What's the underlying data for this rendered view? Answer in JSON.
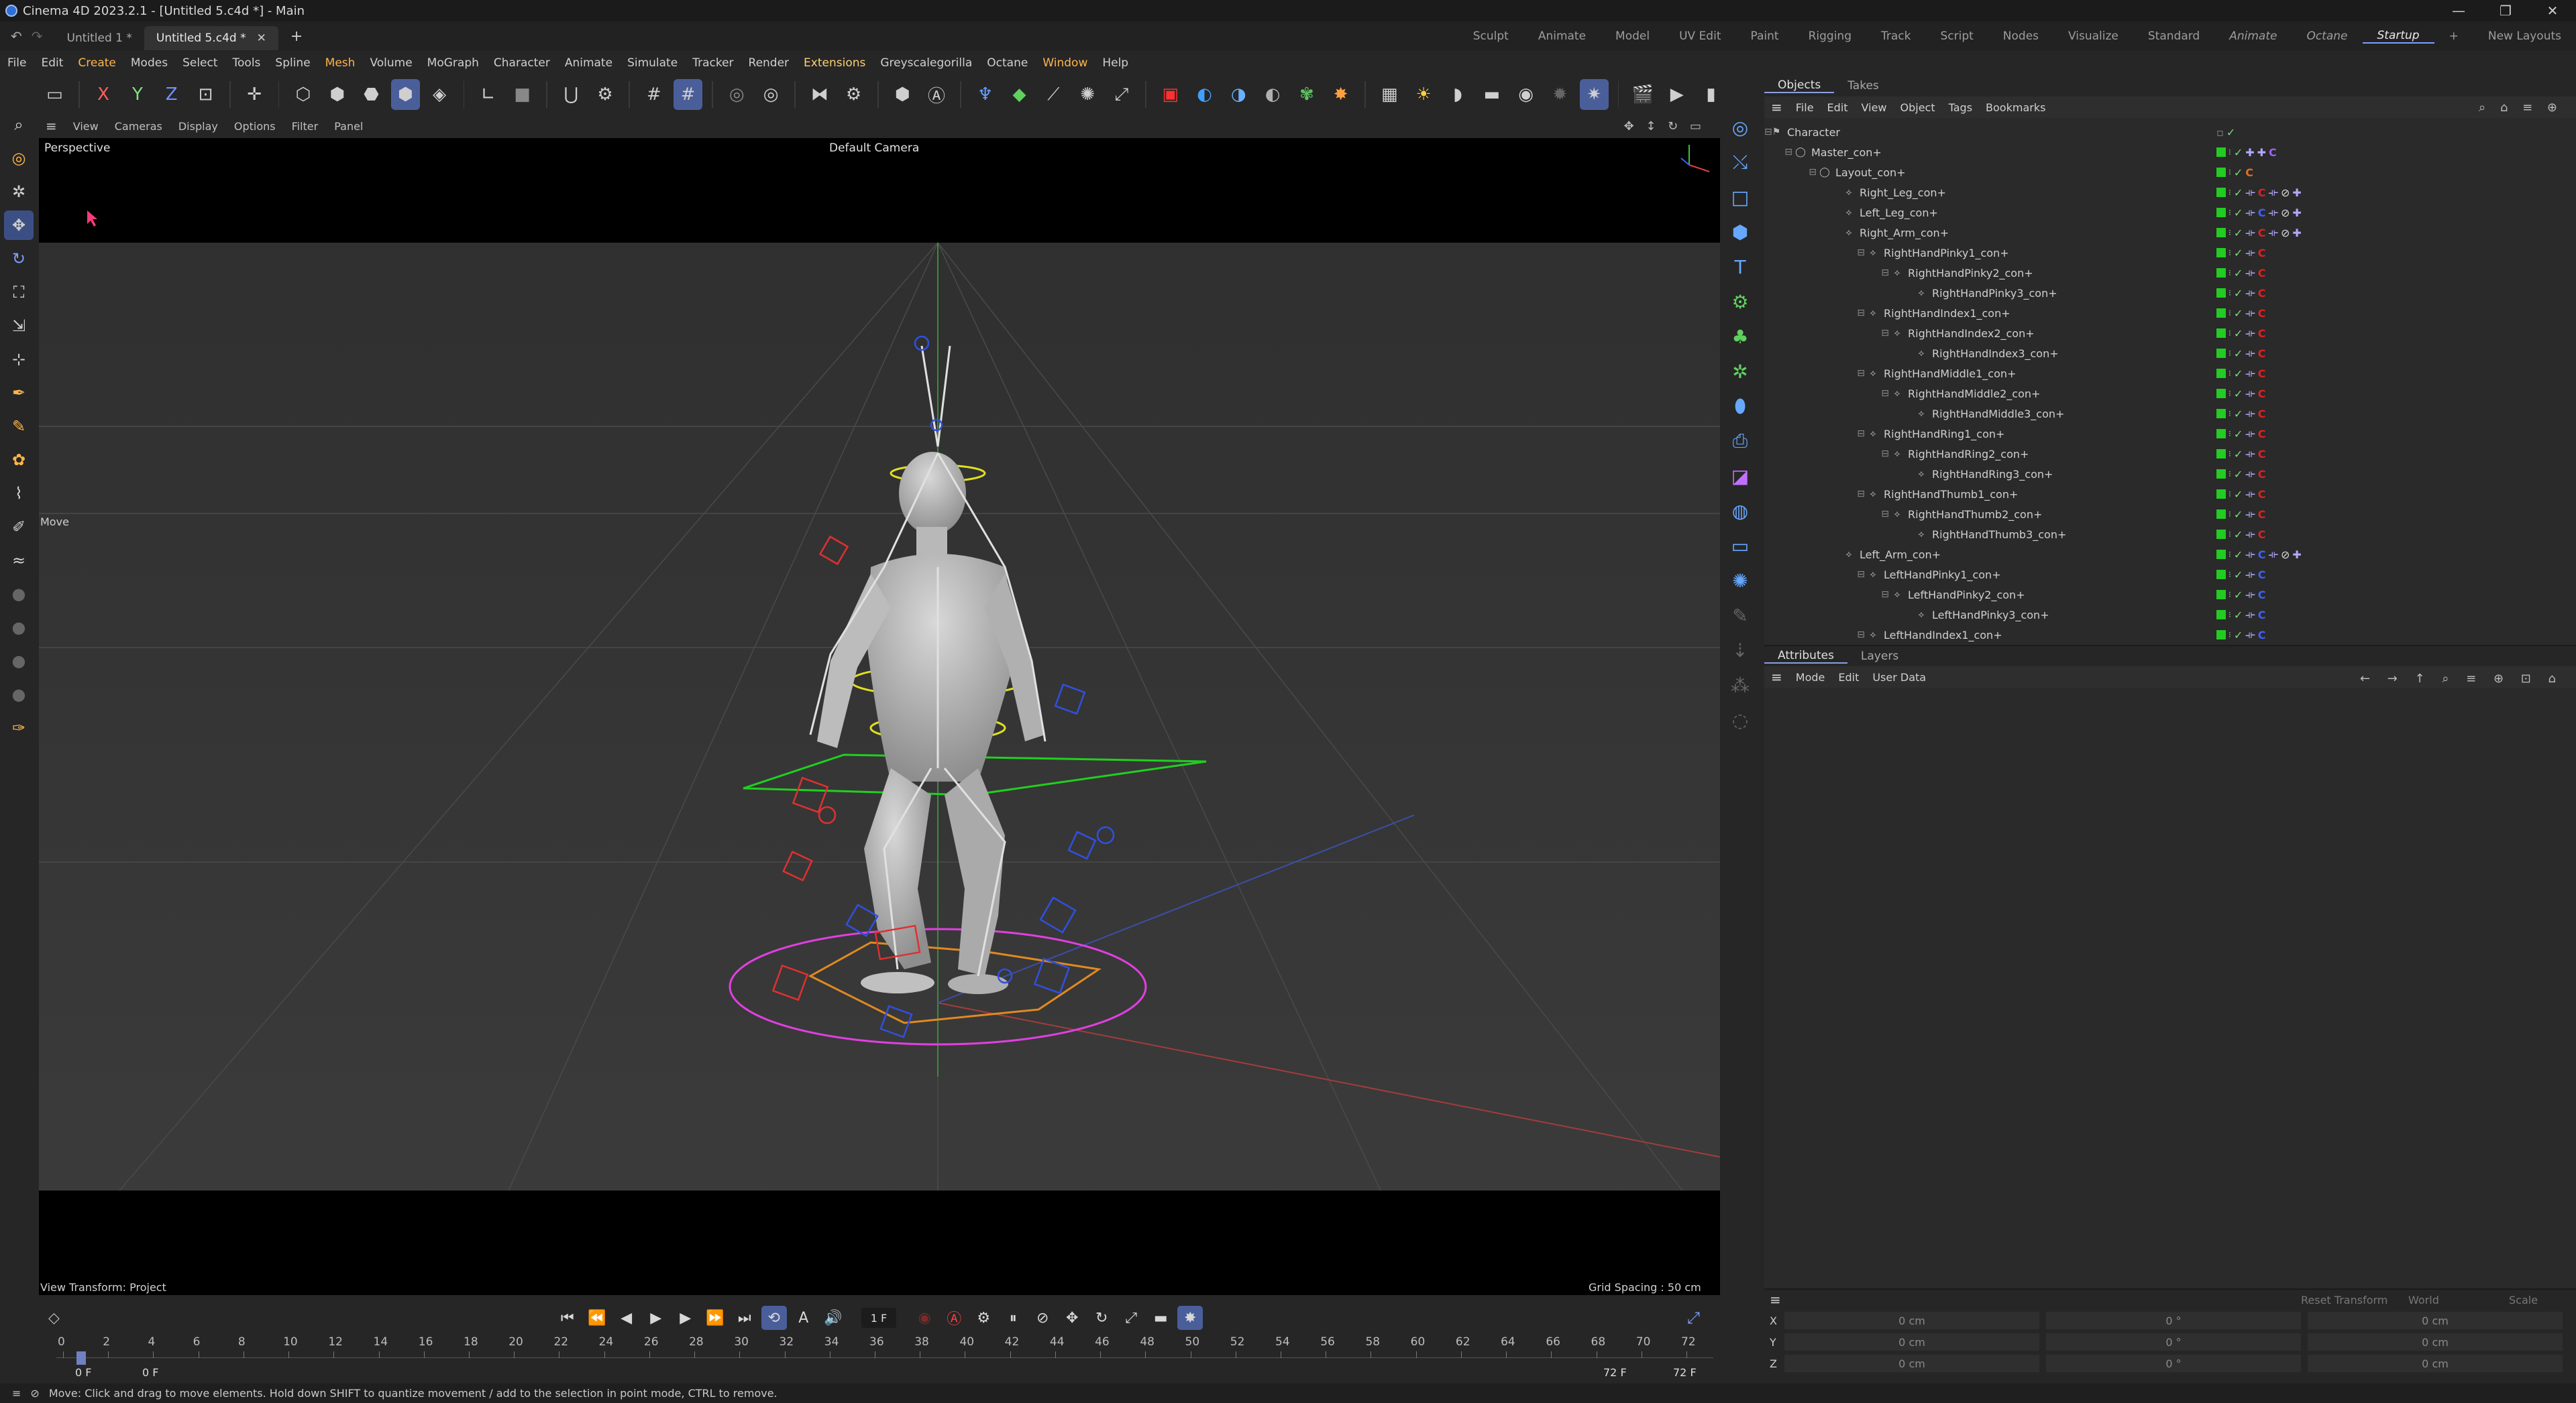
{
  "window": {
    "title": "Cinema 4D 2023.2.1 - [Untitled 5.c4d *] - Main",
    "controls": [
      "—",
      "❐",
      "✕"
    ]
  },
  "doc_tabs": [
    {
      "label": "Untitled 1 *",
      "active": false
    },
    {
      "label": "Untitled 5.c4d *",
      "active": true
    }
  ],
  "layouts": [
    {
      "label": "Sculpt",
      "style": ""
    },
    {
      "label": "Animate",
      "style": ""
    },
    {
      "label": "Model",
      "style": ""
    },
    {
      "label": "UV Edit",
      "style": ""
    },
    {
      "label": "Paint",
      "style": ""
    },
    {
      "label": "Rigging",
      "style": ""
    },
    {
      "label": "Track",
      "style": ""
    },
    {
      "label": "Script",
      "style": ""
    },
    {
      "label": "Nodes",
      "style": ""
    },
    {
      "label": "Visualize",
      "style": ""
    },
    {
      "label": "Standard",
      "style": ""
    },
    {
      "label": "Animate",
      "style": "it"
    },
    {
      "label": "Octane",
      "style": "it"
    },
    {
      "label": "Startup",
      "style": "cur"
    },
    {
      "label": "+",
      "style": ""
    },
    {
      "label": "New Layouts",
      "style": ""
    }
  ],
  "menu": [
    {
      "label": "File",
      "cls": ""
    },
    {
      "label": "Edit",
      "cls": ""
    },
    {
      "label": "Create",
      "cls": "hl"
    },
    {
      "label": "Modes",
      "cls": ""
    },
    {
      "label": "Select",
      "cls": ""
    },
    {
      "label": "Tools",
      "cls": ""
    },
    {
      "label": "Spline",
      "cls": ""
    },
    {
      "label": "Mesh",
      "cls": "hl"
    },
    {
      "label": "Volume",
      "cls": ""
    },
    {
      "label": "MoGraph",
      "cls": ""
    },
    {
      "label": "Character",
      "cls": ""
    },
    {
      "label": "Animate",
      "cls": ""
    },
    {
      "label": "Simulate",
      "cls": ""
    },
    {
      "label": "Tracker",
      "cls": ""
    },
    {
      "label": "Render",
      "cls": ""
    },
    {
      "label": "Extensions",
      "cls": "ext"
    },
    {
      "label": "Greyscalegorilla",
      "cls": ""
    },
    {
      "label": "Octane",
      "cls": ""
    },
    {
      "label": "Window",
      "cls": "hl"
    },
    {
      "label": "Help",
      "cls": ""
    }
  ],
  "viewport": {
    "menu": [
      "View",
      "Cameras",
      "Display",
      "Options",
      "Filter",
      "Panel"
    ],
    "view_name": "Perspective",
    "camera": "Default Camera",
    "tool_label": "Move",
    "view_transform": "View Transform: Project",
    "grid_spacing": "Grid Spacing : 50 cm"
  },
  "objects_panel": {
    "tabs": [
      "Objects",
      "Takes"
    ],
    "menu": [
      "File",
      "Edit",
      "View",
      "Object",
      "Tags",
      "Bookmarks"
    ],
    "rows": [
      {
        "name": "Character",
        "level": 0
      },
      {
        "name": "Master_con+",
        "level": 1
      },
      {
        "name": "Layout_con+",
        "level": 2
      },
      {
        "name": "Right_Leg_con+",
        "level": 3
      },
      {
        "name": "Left_Leg_con+",
        "level": 3
      },
      {
        "name": "Right_Arm_con+",
        "level": 3
      },
      {
        "name": "RightHandPinky1_con+",
        "level": 4
      },
      {
        "name": "RightHandPinky2_con+",
        "level": 5
      },
      {
        "name": "RightHandPinky3_con+",
        "level": 6
      },
      {
        "name": "RightHandIndex1_con+",
        "level": 4
      },
      {
        "name": "RightHandIndex2_con+",
        "level": 5
      },
      {
        "name": "RightHandIndex3_con+",
        "level": 6
      },
      {
        "name": "RightHandMiddle1_con+",
        "level": 4
      },
      {
        "name": "RightHandMiddle2_con+",
        "level": 5
      },
      {
        "name": "RightHandMiddle3_con+",
        "level": 6
      },
      {
        "name": "RightHandRing1_con+",
        "level": 4
      },
      {
        "name": "RightHandRing2_con+",
        "level": 5
      },
      {
        "name": "RightHandRing3_con+",
        "level": 6
      },
      {
        "name": "RightHandThumb1_con+",
        "level": 4
      },
      {
        "name": "RightHandThumb2_con+",
        "level": 5
      },
      {
        "name": "RightHandThumb3_con+",
        "level": 6
      },
      {
        "name": "Left_Arm_con+",
        "level": 3
      },
      {
        "name": "LeftHandPinky1_con+",
        "level": 4
      },
      {
        "name": "LeftHandPinky2_con+",
        "level": 5
      },
      {
        "name": "LeftHandPinky3_con+",
        "level": 6
      },
      {
        "name": "LeftHandIndex1_con+",
        "level": 4
      }
    ]
  },
  "attributes_panel": {
    "tabs": [
      "Attributes",
      "Layers"
    ],
    "menu": [
      "Mode",
      "Edit",
      "User Data"
    ]
  },
  "coordinates": {
    "reset_label": "Reset Transform",
    "space": "World",
    "mode": "Scale",
    "rows": [
      {
        "axis": "X",
        "pos": "0 cm",
        "rot": "0 °",
        "size": "0 cm"
      },
      {
        "axis": "Y",
        "pos": "0 cm",
        "rot": "0 °",
        "size": "0 cm"
      },
      {
        "axis": "Z",
        "pos": "0 cm",
        "rot": "0 °",
        "size": "0 cm"
      }
    ]
  },
  "timeline": {
    "current_frame": "1 F",
    "start_frame": "0 F",
    "min_frame": "0 F",
    "end_frame": "72 F",
    "max_frame": "72 F",
    "ticks": [
      "0",
      "2",
      "4",
      "6",
      "8",
      "10",
      "12",
      "14",
      "16",
      "18",
      "20",
      "22",
      "24",
      "26",
      "28",
      "30",
      "32",
      "34",
      "36",
      "38",
      "40",
      "42",
      "44",
      "46",
      "48",
      "50",
      "52",
      "54",
      "56",
      "58",
      "60",
      "62",
      "64",
      "66",
      "68",
      "70",
      "72"
    ]
  },
  "status": "Move: Click and drag to move elements. Hold down SHIFT to quantize movement / add to the selection in point mode, CTRL to remove.",
  "colors": {
    "accent": "#4a5e9a",
    "tag_green": "#22cc22",
    "constraint_red": "#e02020",
    "constraint_blue": "#4060ff"
  }
}
